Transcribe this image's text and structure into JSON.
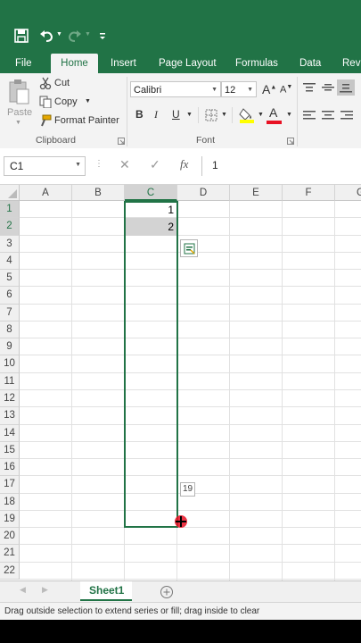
{
  "quick_access": {
    "save_icon": "save-icon",
    "undo_icon": "undo-icon",
    "redo_icon": "redo-icon",
    "customize_icon": "customize-icon"
  },
  "tabs": [
    {
      "label": "File"
    },
    {
      "label": "Home"
    },
    {
      "label": "Insert"
    },
    {
      "label": "Page Layout"
    },
    {
      "label": "Formulas"
    },
    {
      "label": "Data"
    },
    {
      "label": "Revi"
    }
  ],
  "clipboard": {
    "paste_label": "Paste",
    "cut_label": "Cut",
    "copy_label": "Copy",
    "format_painter_label": "Format Painter",
    "group_label": "Clipboard"
  },
  "font": {
    "font_name": "Calibri",
    "font_size": "12",
    "grow_label": "A",
    "shrink_label": "A",
    "bold": "B",
    "italic": "I",
    "underline": "U",
    "font_color_letter": "A",
    "group_label": "Font",
    "fill_color": "#ffff00",
    "font_color": "#e81123"
  },
  "formula_bar": {
    "name_box": "C1",
    "fx_label": "fx",
    "value": "1"
  },
  "columns": [
    "A",
    "B",
    "C",
    "D",
    "E",
    "F",
    "G"
  ],
  "rows": [
    "1",
    "2",
    "3",
    "4",
    "5",
    "6",
    "7",
    "8",
    "9",
    "10",
    "11",
    "12",
    "13",
    "14",
    "15",
    "16",
    "17",
    "18",
    "19",
    "20",
    "21",
    "22"
  ],
  "cells": {
    "C1": "1",
    "C2": "2"
  },
  "fill_tooltip": "19",
  "sheet_tab": "Sheet1",
  "status_text": "Drag outside selection to extend series or fill; drag inside to clear",
  "colors": {
    "accent": "#217346",
    "selection_border": "#217346",
    "crosshair": "#e81123"
  }
}
